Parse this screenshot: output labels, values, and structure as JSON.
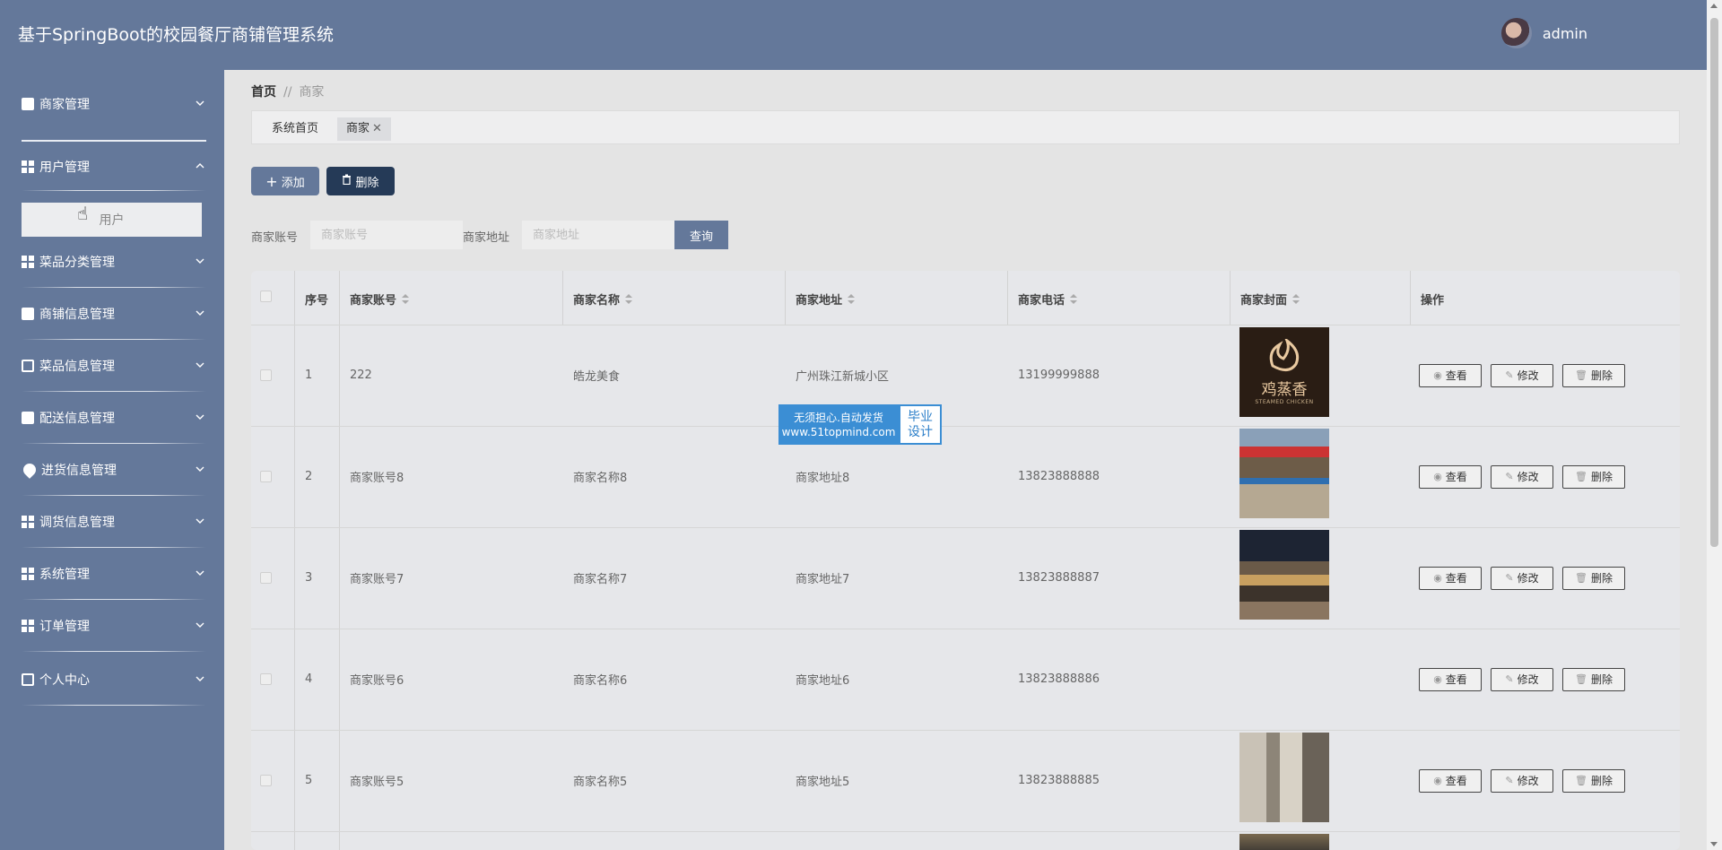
{
  "header": {
    "title": "基于SpringBoot的校园餐厅商铺管理系统",
    "username": "admin"
  },
  "sidebar": {
    "menu_items": [
      {
        "label": "商家管理",
        "icon": "wallet-icon"
      },
      {
        "label": "用户管理",
        "icon": "grid-icon",
        "expanded": true,
        "sub_items": [
          "用户"
        ]
      },
      {
        "label": "菜品分类管理",
        "icon": "grid-icon"
      },
      {
        "label": "商铺信息管理",
        "icon": "chat-icon"
      },
      {
        "label": "菜品信息管理",
        "icon": "box-icon"
      },
      {
        "label": "配送信息管理",
        "icon": "printer-icon"
      },
      {
        "label": "进货信息管理",
        "icon": "pin-icon"
      },
      {
        "label": "调货信息管理",
        "icon": "grid-icon"
      },
      {
        "label": "系统管理",
        "icon": "table-icon"
      },
      {
        "label": "订单管理",
        "icon": "grid-icon"
      },
      {
        "label": "个人中心",
        "icon": "card-icon"
      }
    ]
  },
  "breadcrumb": {
    "home": "首页",
    "separator": "//",
    "current": "商家"
  },
  "tabs": [
    {
      "label": "系统首页"
    },
    {
      "label": "商家"
    }
  ],
  "toolbar": {
    "add_label": "添加",
    "delete_label": "删除"
  },
  "search": {
    "account_label": "商家账号",
    "account_placeholder": "商家账号",
    "address_label": "商家地址",
    "address_placeholder": "商家地址",
    "query_label": "查询"
  },
  "table": {
    "columns": [
      "序号",
      "商家账号",
      "商家名称",
      "商家地址",
      "商家电话",
      "商家封面",
      "操作"
    ],
    "rows": [
      {
        "index": "1",
        "account": "222",
        "name": "皓龙美食",
        "address": "广州珠江新城小区",
        "phone": "13199999888",
        "cover": "logo"
      },
      {
        "index": "2",
        "account": "商家账号8",
        "name": "商家名称8",
        "address": "商家地址8",
        "phone": "13823888888",
        "cover": "storefront"
      },
      {
        "index": "3",
        "account": "商家账号7",
        "name": "商家名称7",
        "address": "商家地址7",
        "phone": "13823888887",
        "cover": "mall"
      },
      {
        "index": "4",
        "account": "商家账号6",
        "name": "商家名称6",
        "address": "商家地址6",
        "phone": "13823888886",
        "cover": "none"
      },
      {
        "index": "5",
        "account": "商家账号5",
        "name": "商家名称5",
        "address": "商家地址5",
        "phone": "13823888885",
        "cover": "street"
      }
    ],
    "actions": {
      "view": "查看",
      "edit": "修改",
      "delete": "删除"
    }
  },
  "cover_logo_text": {
    "cn": "鸡蒸香",
    "en": "STEAMED CHICKEN"
  },
  "watermark": {
    "line1": "无须担心.自动发货",
    "line2": "www.51topmind.com",
    "side1": "毕业",
    "side2": "设计"
  },
  "colors": {
    "primary": "#64789a",
    "danger_dark": "#253a57",
    "background": "#e4e4e4"
  }
}
